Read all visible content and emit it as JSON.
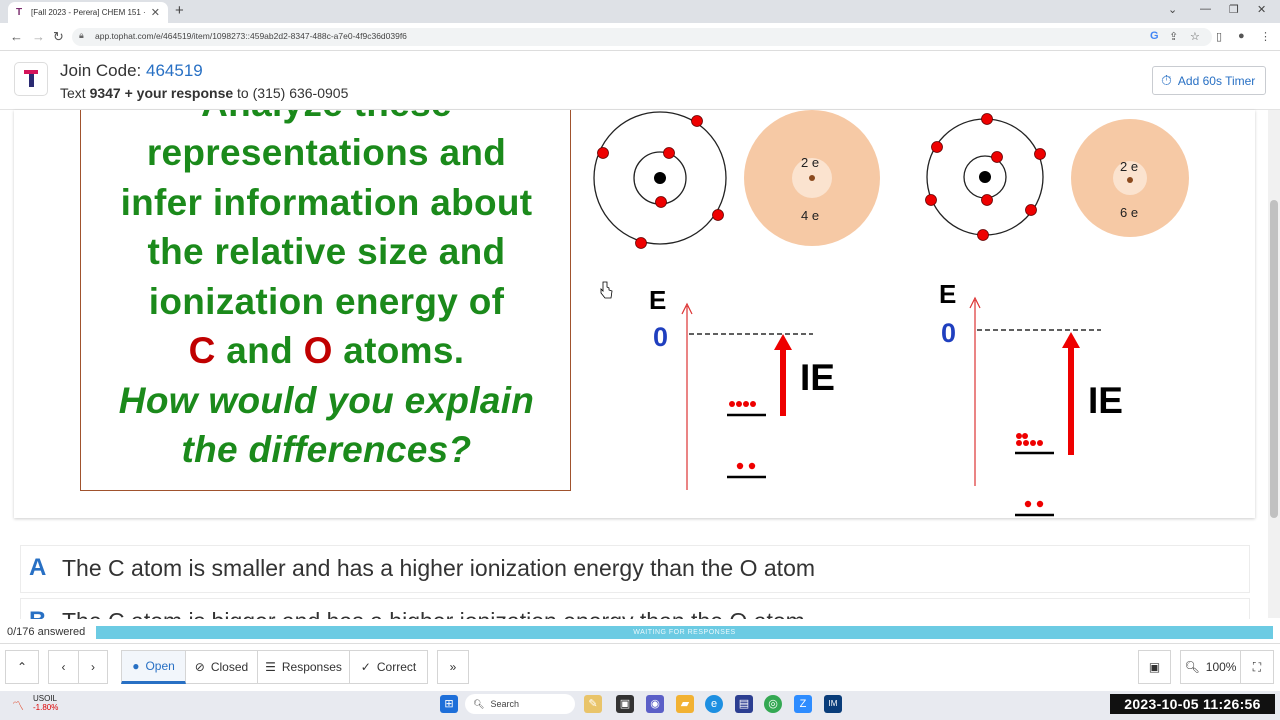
{
  "browser": {
    "tab_title": "[Fall 2023 - Perera] CHEM 151 ·",
    "url": "app.tophat.com/e/464519/item/1098273::459ab2d2-8347-488c-a7e0-4f9c36d039f6"
  },
  "header": {
    "join_label": "Join Code:",
    "join_code": "464519",
    "text_prefix": "Text",
    "text_code": "9347 + your response",
    "text_to": "to",
    "phone": "(315) 636-0905",
    "timer_label": "Add 60s Timer"
  },
  "slide": {
    "lines": [
      "Analyze these",
      "representations and",
      "infer information about",
      "the relative size and",
      "ionization energy of"
    ],
    "atom_c": "C",
    "and_word": "and",
    "atom_o": "O",
    "atoms_word": "atoms.",
    "question_lines": [
      "How would you explain",
      "the differences?"
    ],
    "diagram": {
      "c_inner": "2 e",
      "c_outer": "4 e",
      "o_inner": "2 e",
      "o_outer": "6 e",
      "energy_label": "E",
      "zero_label": "0",
      "ie_label": "IE"
    }
  },
  "answers": [
    {
      "letter": "A",
      "text": "The C atom is smaller and has a higher ionization energy than the O atom"
    },
    {
      "letter": "B",
      "text": "The C atom is bigger and has a higher ionization energy than the O atom"
    }
  ],
  "status": {
    "answered": "0/176 answered",
    "waiting": "WAITING FOR RESPONSES"
  },
  "toolbar": {
    "open": "Open",
    "closed": "Closed",
    "responses": "Responses",
    "correct": "Correct",
    "zoom": "100%"
  },
  "taskbar": {
    "stock_name": "USOIL",
    "stock_change": "-1.80%",
    "search": "Search",
    "clock": "2023-10-05  11:26:56"
  },
  "colors": {
    "accent": "#2870c4",
    "slide_green": "#1b8a1b",
    "slide_red": "#c00000",
    "progress": "#6ccbe3"
  }
}
